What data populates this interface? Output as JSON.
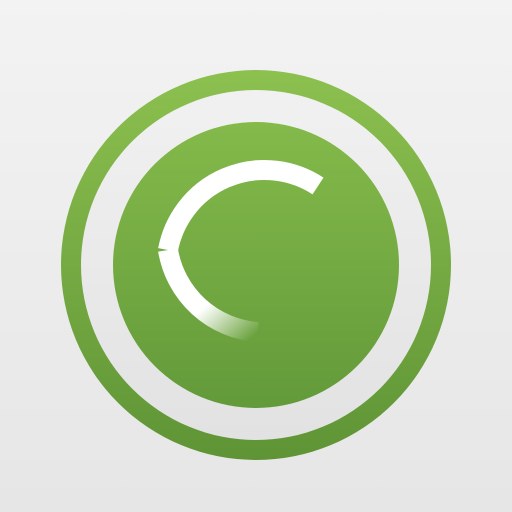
{
  "icon": {
    "name": "green-concentric-circles-with-c-arc-icon",
    "colors": {
      "background_top": "#f3f3f3",
      "background_bottom": "#e6e6e6",
      "green_light": "#8cc04f",
      "green_dark": "#5f9436",
      "ring_gap": "#ececec",
      "arc": "#ffffff"
    }
  }
}
